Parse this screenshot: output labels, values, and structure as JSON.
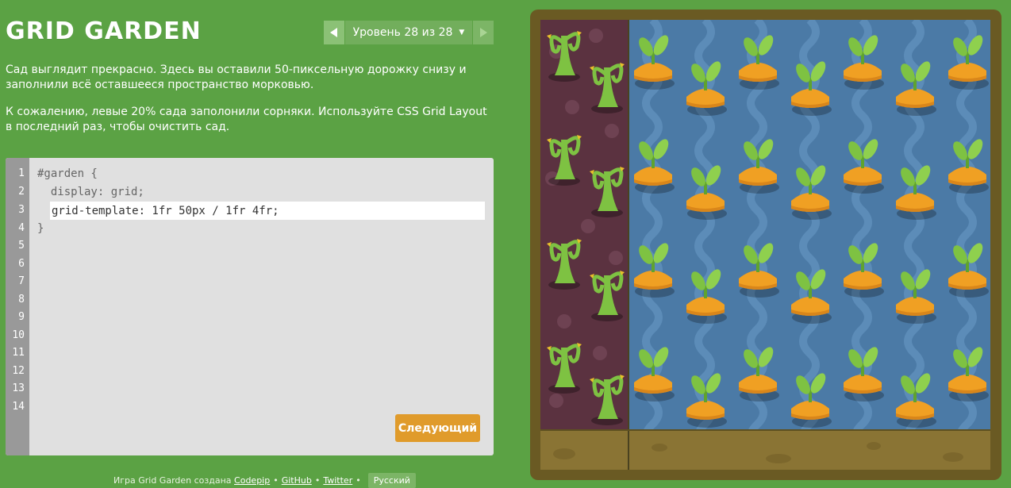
{
  "header": {
    "logo": "GRID GARDEN",
    "level_label": "Уровень 28 из 28",
    "caret": "▼"
  },
  "instructions": {
    "p1": "Сад выглядит прекрасно. Здесь вы оставили 50-пиксельную дорожку снизу и заполнили всё оставшееся пространство морковью.",
    "p2": "К сожалению, левые 20% сада заполонили сорняки. Используйте CSS Grid Layout в последний раз, чтобы очистить сад."
  },
  "editor": {
    "line_numbers": [
      "1",
      "2",
      "3",
      "4",
      "5",
      "6",
      "7",
      "8",
      "9",
      "10",
      "11",
      "12",
      "13",
      "14"
    ],
    "line1": "#garden {",
    "line2": "  display: grid;",
    "input_value": "grid-template: 1fr 50px / 1fr 4fr;",
    "line4": "}",
    "next_label": "Следующий"
  },
  "footer": {
    "prefix": "Игра Grid Garden создана",
    "codepip": "Codepip",
    "github": "GitHub",
    "twitter": "Twitter",
    "bullet": "•",
    "language": "Русский"
  },
  "garden": {
    "weeds_color": "#5b3240",
    "water_color": "#4b7aa6",
    "soil_color": "#8a7434",
    "carrot_color": "#f0a023",
    "leaf_color": "#7ec242",
    "weed_count": 8,
    "carrot_count": 28
  }
}
